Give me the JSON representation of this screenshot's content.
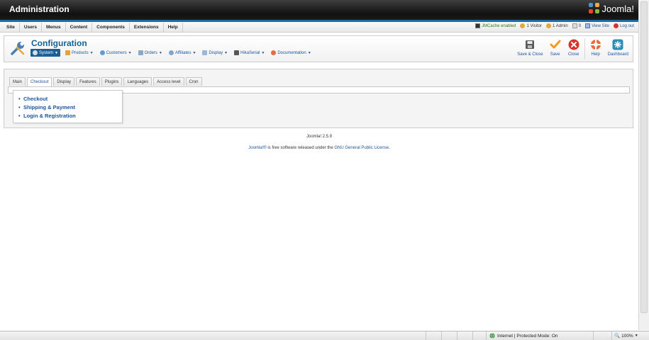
{
  "header": {
    "title": "Administration",
    "logo_text": "Joomla!"
  },
  "menubar": {
    "items": [
      "Site",
      "Users",
      "Menus",
      "Content",
      "Components",
      "Extensions",
      "Help"
    ],
    "status": {
      "cache": "JMCache enabled",
      "visitors": "1 Visitor",
      "admins": "1 Admin",
      "messages": "0",
      "view_site": "View Site",
      "logout": "Log out"
    }
  },
  "toolbar": {
    "title": "Configuration",
    "submenu": [
      {
        "label": "System",
        "icon": "system-icon"
      },
      {
        "label": "Products",
        "icon": "products-icon"
      },
      {
        "label": "Customers",
        "icon": "customers-icon"
      },
      {
        "label": "Orders",
        "icon": "orders-icon"
      },
      {
        "label": "Affiliates",
        "icon": "affiliates-icon"
      },
      {
        "label": "Display",
        "icon": "display-icon"
      },
      {
        "label": "HikaSerial",
        "icon": "hikaserial-icon"
      },
      {
        "label": "Documentation",
        "icon": "documentation-icon"
      }
    ],
    "buttons": {
      "save_close": "Save & Close",
      "save": "Save",
      "close": "Close",
      "help": "Help",
      "dashboard": "Dashboard"
    }
  },
  "tabs": [
    "Main",
    "Checkout",
    "Display",
    "Features",
    "Plugins",
    "Languages",
    "Access level",
    "Cron"
  ],
  "active_tab": "Checkout",
  "dropdown": [
    "Checkout",
    "Shipping & Payment",
    "Login & Registration"
  ],
  "footer": {
    "version": "Joomla! 2.5.9",
    "license_prefix": "Joomla!®",
    "license_middle": " is free software released under the ",
    "license_link": "GNU General Public License",
    "license_suffix": "."
  },
  "statusbar": {
    "zone": "Internet | Protected Mode: On",
    "zoom": "100%"
  },
  "colors": {
    "accent": "#1a56a0",
    "header_bg": "#111111",
    "header_line": "#1c6ea8",
    "close_red": "#d9342b",
    "save_orange": "#f29d12"
  }
}
